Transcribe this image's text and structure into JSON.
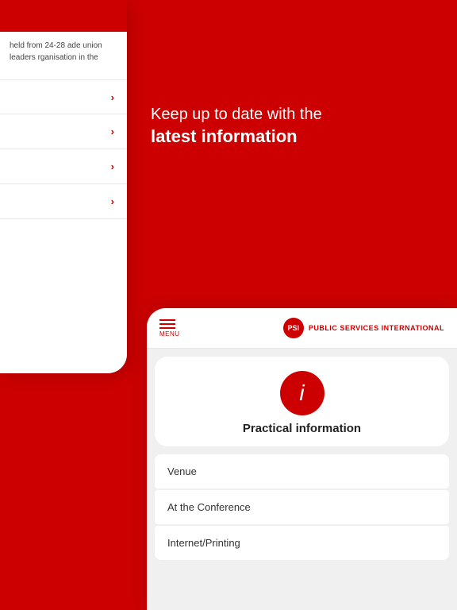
{
  "background": {
    "color": "#cc0000"
  },
  "hero": {
    "line1": "Keep up to date with the",
    "line2": "latest information"
  },
  "left_card": {
    "text": "held from 24-28\nade union leaders\nrganisation in the",
    "items": [
      {
        "label": ""
      },
      {
        "label": ""
      },
      {
        "label": ""
      },
      {
        "label": ""
      }
    ]
  },
  "bottom_card": {
    "menu_label": "MENU",
    "logo_initials": "PSI",
    "logo_text": "PUBLIC SERVICES INTERNATIONAL",
    "info_icon": "i",
    "practical_info_title": "Practical information",
    "list_items": [
      {
        "label": "Venue"
      },
      {
        "label": "At the Conference"
      },
      {
        "label": "Internet/Printing"
      }
    ]
  }
}
